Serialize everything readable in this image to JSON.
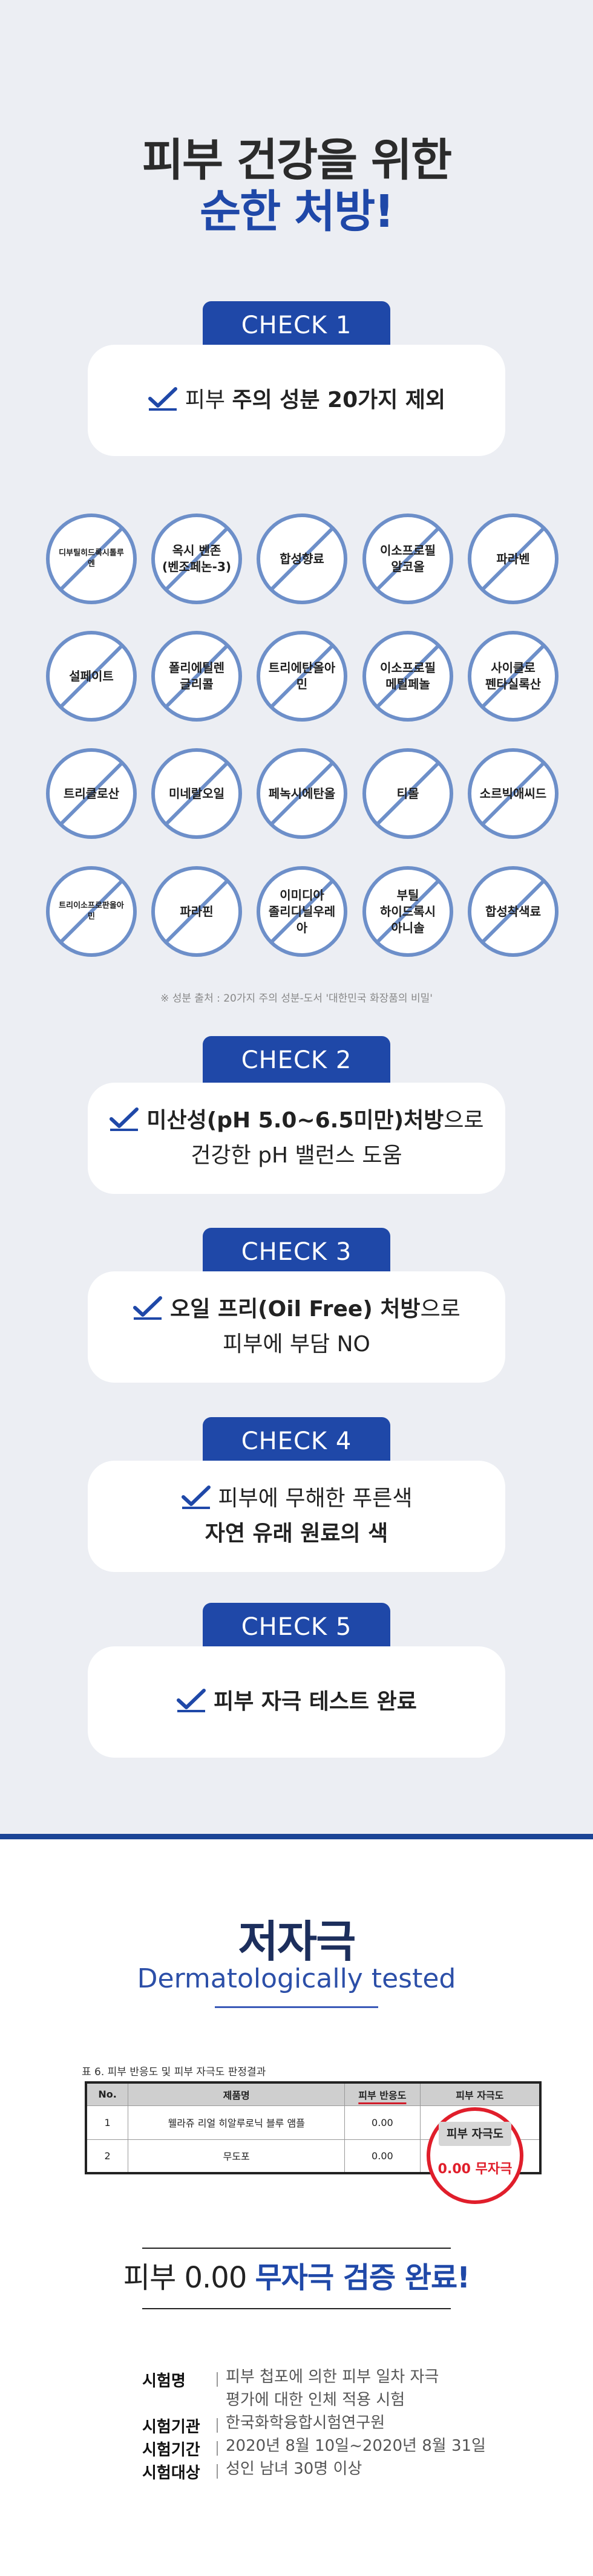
{
  "hero": {
    "line1": "피부 건강을 위한",
    "line2": "순한 처방!"
  },
  "checks": [
    {
      "tab": "CHECK 1",
      "rows": [
        {
          "check": true,
          "parts": [
            {
              "t": "피부 ",
              "b": false
            },
            {
              "t": "주의 성분 20가지 제외",
              "b": true
            }
          ]
        }
      ]
    },
    {
      "tab": "CHECK 2",
      "rows": [
        {
          "check": true,
          "parts": [
            {
              "t": "미산성(pH 5.0~6.5미만)처방",
              "b": true
            },
            {
              "t": "으로",
              "b": false
            }
          ]
        },
        {
          "check": false,
          "parts": [
            {
              "t": "건강한 pH 밸런스 도움",
              "b": false
            }
          ]
        }
      ]
    },
    {
      "tab": "CHECK 3",
      "rows": [
        {
          "check": true,
          "parts": [
            {
              "t": "오일 프리(Oil Free) 처방",
              "b": true
            },
            {
              "t": "으로",
              "b": false
            }
          ]
        },
        {
          "check": false,
          "parts": [
            {
              "t": "피부에 부담 NO",
              "b": false
            }
          ]
        }
      ]
    },
    {
      "tab": "CHECK 4",
      "rows": [
        {
          "check": true,
          "parts": [
            {
              "t": "피부에 무해한 푸른색",
              "b": false
            }
          ]
        },
        {
          "check": false,
          "parts": [
            {
              "t": "자연 유래 원료의 색",
              "b": true
            }
          ]
        }
      ]
    },
    {
      "tab": "CHECK 5",
      "rows": [
        {
          "check": true,
          "parts": [
            {
              "t": "피부 자극 테스트 완료",
              "b": true
            }
          ]
        }
      ]
    }
  ],
  "ingredients": [
    "디부틸히드록시톨루엔",
    "옥시 벤존\n(벤조페논-3)",
    "합성향료",
    "이소프로필\n알코올",
    "파라벤",
    "설페이트",
    "폴리에틸렌\n글리콜",
    "트리에탄올아민",
    "이소프로필\n메틸페놀",
    "사이클로\n펜타실록산",
    "트리클로산",
    "미네랄오일",
    "페녹시에탄올",
    "티몰",
    "소르빅애씨드",
    "트리이소프로판올아민",
    "파라핀",
    "이미디아\n졸리디닐우레아",
    "부틸\n하이드록시\n아니솔",
    "합성착색료"
  ],
  "source_note": "※ 성분 출처 : 20가지 주의 성분-도서 '대한민국 화장품의 비밀'",
  "derma": {
    "title": "저자극",
    "subtitle": "Dermatologically tested"
  },
  "table": {
    "caption": "표 6. 피부 반응도 및 피부 자극도 판정결과",
    "headers": [
      "No.",
      "제품명",
      "피부 반응도",
      "피부 자극도"
    ],
    "rows": [
      [
        "1",
        "웰라쥬 리얼 히알루로닉 블루 앰플",
        "0.00",
        ""
      ],
      [
        "2",
        "무도포",
        "0.00",
        ""
      ]
    ],
    "badge_header": "피부 자극도",
    "badge_value": "0.00 무자극"
  },
  "verify": {
    "prefix": "피부 0.00 ",
    "highlight": "무자극 검증 완료!"
  },
  "info": [
    {
      "label": "시험명",
      "value": "피부 첩포에 의한 피부 일차 자극\n평가에 대한 인체 적용 시험"
    },
    {
      "label": "시험기관",
      "value": "한국화학융합시험연구원"
    },
    {
      "label": "시험기간",
      "value": "2020년 8월 10일~2020년 8월 31일"
    },
    {
      "label": "시험대상",
      "value": "성인 남녀 30명 이상"
    }
  ],
  "colors": {
    "primary": "#1f48a8",
    "background": "#eceef3",
    "circle": "#6d8fc9",
    "red": "#e01e2b",
    "divider": "#1c4596"
  }
}
